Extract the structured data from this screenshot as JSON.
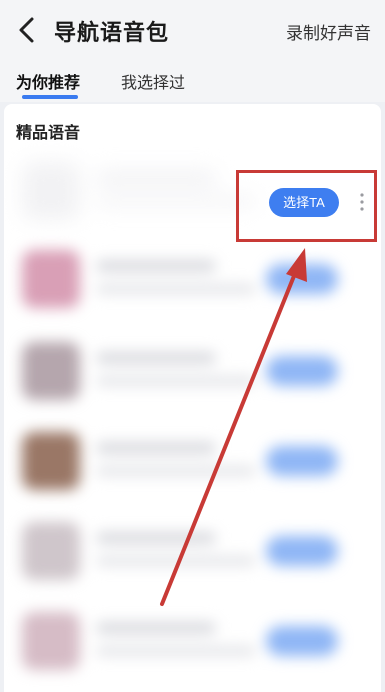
{
  "header": {
    "title": "导航语音包",
    "record_label": "录制好声音",
    "back_icon": "chevron-left-icon"
  },
  "tabs": [
    {
      "label": "为你推荐",
      "active": true
    },
    {
      "label": "我选择过",
      "active": false
    }
  ],
  "section": {
    "title": "精品语音"
  },
  "first_item": {
    "select_label": "选择TA",
    "more_icon": "more-vertical-icon"
  },
  "colors": {
    "accent": "#3e7ef0",
    "annotation": "#c83a36",
    "background": "#eef0f4"
  }
}
